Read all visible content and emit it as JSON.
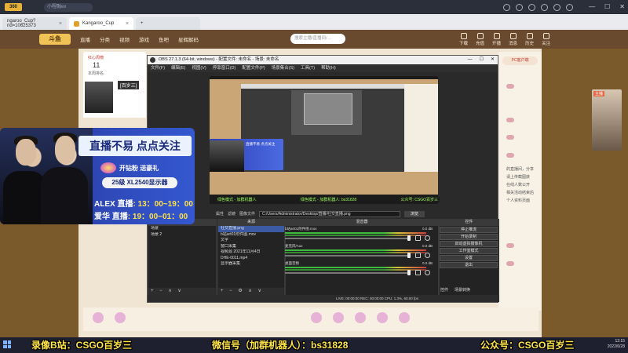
{
  "browser": {
    "search_text": "小程融ex",
    "tabs": [
      {
        "label": "ngaroo_Cup?rid=10625373"
      },
      {
        "label": "Kangaroo_Cup"
      }
    ]
  },
  "site": {
    "brand": "斗鱼",
    "nav": [
      "直播",
      "分类",
      "视频",
      "游戏",
      "鱼吧",
      "星辉解码"
    ],
    "search_placeholder": "搜索主播/直播间/…",
    "right_nav": [
      "下载",
      "充值",
      "开播",
      "消息",
      "历史",
      "关注"
    ]
  },
  "room": {
    "rank_label": "红心周榜",
    "rank_value": "11",
    "rank_caption": "本周排名",
    "anchor_name": "[百岁三]",
    "pc_badge": "PC客户端",
    "right_ad_label": "主播",
    "chat_lines": [
      "的直播间，分享",
      "请上传截图获",
      "在线人数公开",
      "相关活动结束后",
      "个人资料页面"
    ]
  },
  "obs": {
    "title": "OBS 27.1.3 (64-bit, windows) - 配置文件: 未命名 - 场景: 未命名",
    "menu": [
      "文件(F)",
      "编辑(E)",
      "视图(V)",
      "停靠窗口(D)",
      "配置文件(P)",
      "场景集合(S)",
      "工具(T)",
      "帮助(H)"
    ],
    "preview_captions": [
      "绿色模式 - 加群机器人",
      "绿色模式 - 加群机器人: bs31828",
      "公众号: CSGO百岁三"
    ],
    "property_label": "属性",
    "filter_label": "滤镜",
    "path_label": "图像文件",
    "path_value": "C:/Users/Administrator/Desktop/直播/社交直播.png",
    "path_browse": "浏览",
    "docks": {
      "scenes": {
        "title": "场景",
        "items": [
          "场景",
          "场景 2"
        ]
      },
      "sources": {
        "title": "来源",
        "items": [
          "社交直播.png",
          "b站art01附件图.mov",
          "文字",
          "窗口采集",
          "视频源 2021年11月4日",
          "DHE-0011.mp4",
          "显示器采集"
        ]
      },
      "mixer": {
        "title": "混音器",
        "channels": [
          {
            "name": "b站art01附件图.mov",
            "db": "0.0 dB"
          },
          {
            "name": "麦克风/Aux",
            "db": "0.0 dB"
          },
          {
            "name": "桌面音频",
            "db": "0.0 dB"
          }
        ]
      },
      "controls": {
        "title": "控件",
        "buttons": [
          "停止推流",
          "开始录制",
          "启动虚拟摄像机",
          "工作室模式",
          "设置",
          "退出"
        ]
      }
    },
    "bottom_tabs": [
      "控件",
      "场景转换"
    ],
    "status": "LIVE: 00:00:00   REC: 00:00:00   CPU: 1.3%, 60.00 fps"
  },
  "overlay": {
    "title": "直播不易 点点关注",
    "badge": "开钻粉 送豪礼",
    "prize": "25级 XL2540显示器",
    "schedule": [
      {
        "name": "ALEX 直播",
        "time": ": 13：00~19：00"
      },
      {
        "name": "爱华 直播",
        "time": ": 19：00~01：00"
      }
    ]
  },
  "captions": {
    "left": "录像B站：CSGO百岁三",
    "middle": "微信号（加群机器人）：bs31828",
    "right": "公众号：CSGO百岁三"
  },
  "clock": {
    "time": "12:15",
    "date": "2022/6/28"
  }
}
